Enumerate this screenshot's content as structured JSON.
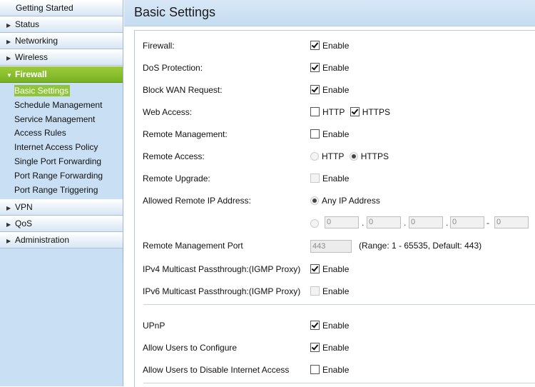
{
  "sidebar": {
    "getting_started": "Getting Started",
    "status": "Status",
    "networking": "Networking",
    "wireless": "Wireless",
    "firewall": "Firewall",
    "firewall_items": [
      "Basic Settings",
      "Schedule Management",
      "Service Management",
      "Access Rules",
      "Internet Access Policy",
      "Single Port Forwarding",
      "Port Range Forwarding",
      "Port Range Triggering"
    ],
    "vpn": "VPN",
    "qos": "QoS",
    "administration": "Administration",
    "accent_color": "#80b82a"
  },
  "page": {
    "title": "Basic Settings"
  },
  "settings": {
    "firewall": {
      "label": "Firewall:",
      "option": "Enable",
      "checked": true
    },
    "dos": {
      "label": "DoS Protection:",
      "option": "Enable",
      "checked": true
    },
    "block_wan": {
      "label": "Block WAN Request:",
      "option": "Enable",
      "checked": true
    },
    "web_access": {
      "label": "Web Access:",
      "http": "HTTP",
      "https": "HTTPS",
      "http_checked": false,
      "https_checked": true
    },
    "remote_mgmt": {
      "label": "Remote Management:",
      "option": "Enable",
      "checked": false
    },
    "remote_access": {
      "label": "Remote Access:",
      "http": "HTTP",
      "https": "HTTPS",
      "selected": "HTTPS"
    },
    "remote_upgrade": {
      "label": "Remote Upgrade:",
      "option": "Enable",
      "checked": false,
      "disabled": true
    },
    "allowed_ip": {
      "label": "Allowed Remote IP Address:",
      "any": "Any IP Address",
      "ip_fields": [
        "0",
        "0",
        "0",
        "0",
        "0"
      ],
      "dot": ".",
      "dash": "-"
    },
    "mgmt_port": {
      "label": "Remote Management Port",
      "value": "443",
      "range": "(Range: 1 - 65535, Default: 443)"
    },
    "ipv4_multicast": {
      "label": "IPv4 Multicast Passthrough:(IGMP Proxy)",
      "option": "Enable",
      "checked": true
    },
    "ipv6_multicast": {
      "label": "IPv6 Multicast Passthrough:(IGMP Proxy)",
      "option": "Enable",
      "checked": false,
      "disabled": true
    },
    "upnp": {
      "label": "UPnP",
      "option": "Enable",
      "checked": true
    },
    "allow_configure": {
      "label": "Allow Users to Configure",
      "option": "Enable",
      "checked": true
    },
    "allow_disable": {
      "label": "Allow Users to Disable Internet Access",
      "option": "Enable",
      "checked": false
    }
  }
}
